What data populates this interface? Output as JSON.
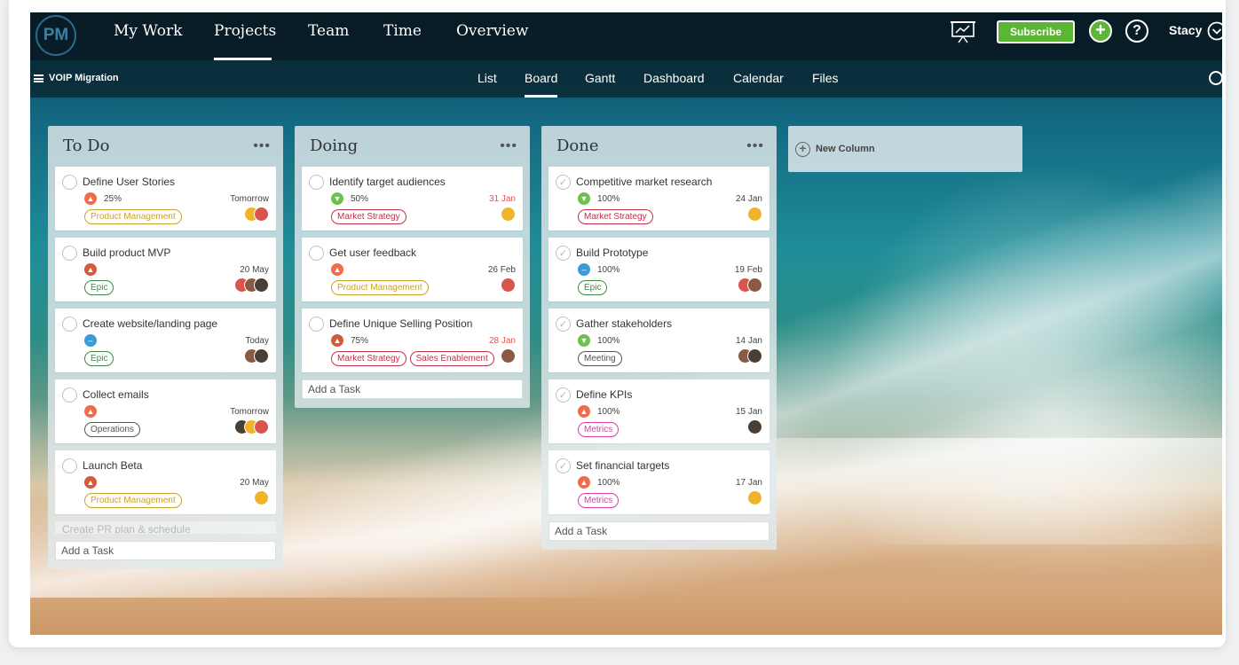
{
  "app": {
    "logo": "PM"
  },
  "topnav": {
    "items": [
      {
        "label": "My Work"
      },
      {
        "label": "Projects",
        "active": true
      },
      {
        "label": "Team"
      },
      {
        "label": "Time"
      },
      {
        "label": "Overview"
      }
    ],
    "subscribe_label": "Subscribe",
    "user_name": "Stacy",
    "accent_color": "#5cb535"
  },
  "subnav": {
    "project_name": "VOIP Migration",
    "tabs": [
      {
        "label": "List"
      },
      {
        "label": "Board",
        "active": true
      },
      {
        "label": "Gantt"
      },
      {
        "label": "Dashboard"
      },
      {
        "label": "Calendar"
      },
      {
        "label": "Files"
      }
    ]
  },
  "board": {
    "add_task_label": "Add a Task",
    "new_column_label": "New Column",
    "columns": [
      {
        "title": "To Do",
        "cards": [
          {
            "title": "Define User Stories",
            "priority": "high",
            "progress": "25%",
            "due": "Tomorrow",
            "due_late": false,
            "tags": [
              {
                "label": "Product Management",
                "color": "#c9a227"
              }
            ],
            "avatars": 2
          },
          {
            "title": "Build product MVP",
            "priority": "critical",
            "progress": "",
            "due": "20 May",
            "due_late": false,
            "tags": [
              {
                "label": "Epic",
                "color": "#3d8b40"
              }
            ],
            "avatars": 3
          },
          {
            "title": "Create website/landing page",
            "priority": "medium",
            "progress": "",
            "due": "Today",
            "due_late": false,
            "tags": [
              {
                "label": "Epic",
                "color": "#3d8b40"
              }
            ],
            "avatars": 2
          },
          {
            "title": "Collect emails",
            "priority": "high",
            "progress": "",
            "due": "Tomorrow",
            "due_late": false,
            "tags": [
              {
                "label": "Operations",
                "color": "#555555"
              }
            ],
            "avatars": 3
          },
          {
            "title": "Launch Beta",
            "priority": "critical",
            "progress": "",
            "due": "20 May",
            "due_late": false,
            "tags": [
              {
                "label": "Product Management",
                "color": "#c9a227"
              }
            ],
            "avatars": 1
          }
        ],
        "ghost_card": "Create PR plan & schedule"
      },
      {
        "title": "Doing",
        "cards": [
          {
            "title": "Identify target audiences",
            "priority": "low",
            "progress": "50%",
            "due": "31 Jan",
            "due_late": true,
            "tags": [
              {
                "label": "Market Strategy",
                "color": "#c0314a"
              }
            ],
            "avatars": 1
          },
          {
            "title": "Get user feedback",
            "priority": "high",
            "progress": "",
            "due": "26 Feb",
            "due_late": false,
            "tags": [
              {
                "label": "Product Management",
                "color": "#c9a227"
              }
            ],
            "avatars": 1
          },
          {
            "title": "Define Unique Selling Position",
            "priority": "critical",
            "progress": "75%",
            "due": "28 Jan",
            "due_late": true,
            "tags": [
              {
                "label": "Market Strategy",
                "color": "#c0314a"
              },
              {
                "label": "Sales Enablement",
                "color": "#c0314a"
              }
            ],
            "avatars": 1
          }
        ]
      },
      {
        "title": "Done",
        "cards": [
          {
            "title": "Competitive market research",
            "priority": "low",
            "progress": "100%",
            "due": "24 Jan",
            "due_late": false,
            "tags": [
              {
                "label": "Market Strategy",
                "color": "#c0314a"
              }
            ],
            "avatars": 1
          },
          {
            "title": "Build Prototype",
            "priority": "medium",
            "progress": "100%",
            "due": "19 Feb",
            "due_late": false,
            "tags": [
              {
                "label": "Epic",
                "color": "#3d8b40"
              }
            ],
            "avatars": 2
          },
          {
            "title": "Gather stakeholders",
            "priority": "low",
            "progress": "100%",
            "due": "14 Jan",
            "due_late": false,
            "tags": [
              {
                "label": "Meeting",
                "color": "#555555"
              }
            ],
            "avatars": 2
          },
          {
            "title": "Define KPIs",
            "priority": "high",
            "progress": "100%",
            "due": "15 Jan",
            "due_late": false,
            "tags": [
              {
                "label": "Metrics",
                "color": "#d63fa8"
              }
            ],
            "avatars": 1
          },
          {
            "title": "Set financial targets",
            "priority": "high",
            "progress": "100%",
            "due": "17 Jan",
            "due_late": false,
            "tags": [
              {
                "label": "Metrics",
                "color": "#d63fa8"
              }
            ],
            "avatars": 1
          }
        ]
      }
    ]
  }
}
